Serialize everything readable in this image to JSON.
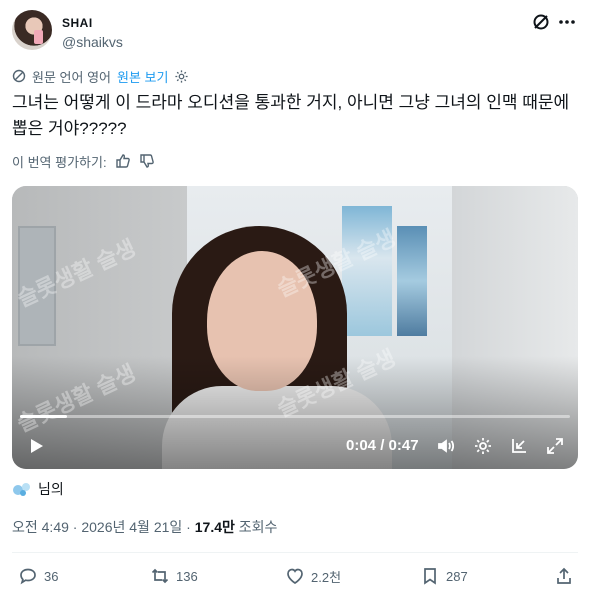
{
  "author": {
    "name": "SHAI",
    "handle": "@shaikvs"
  },
  "translation": {
    "note": "원문 언어 영어",
    "original_link": "원본 보기"
  },
  "tweet": {
    "text": "그녀는 어떻게 이 드라마 오디션을 통과한 거지, 아니면 그냥 그녀의 인맥 때문에 뽑은 거야?????"
  },
  "rate_translation": "이 번역 평가하기:",
  "video": {
    "time": "0:04 / 0:47",
    "progress": 0.085
  },
  "watermark": "슬롯생활 슬생",
  "liked_by": "님의",
  "meta": {
    "time": "오전 4:49",
    "separator": " · ",
    "date": "2026년 4월 21일",
    "views": "17.4만",
    "views_label": "조회수"
  },
  "actions": {
    "replies": "36",
    "reposts": "136",
    "likes": "2.2천",
    "bookmarks": "287"
  },
  "colors": {
    "accent": "#1d9bf0",
    "muted": "#536471",
    "text": "#0f1419"
  }
}
